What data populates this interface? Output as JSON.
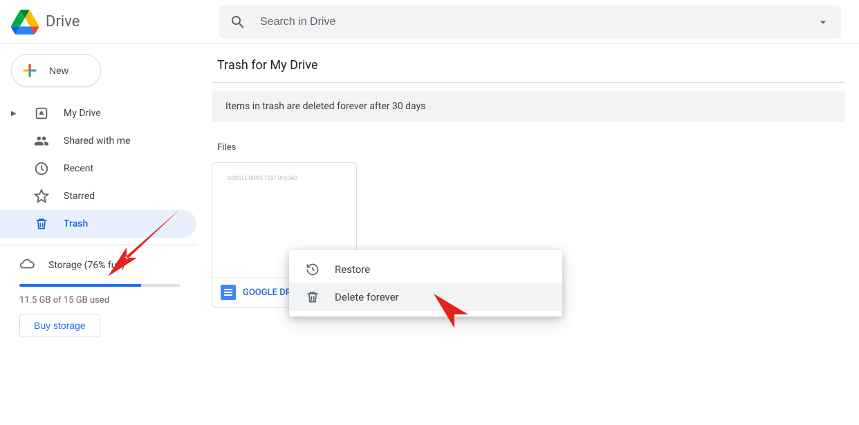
{
  "app": {
    "name": "Drive"
  },
  "search": {
    "placeholder": "Search in Drive"
  },
  "sidebar": {
    "new_label": "New",
    "items": [
      {
        "label": "My Drive"
      },
      {
        "label": "Shared with me"
      },
      {
        "label": "Recent"
      },
      {
        "label": "Starred"
      },
      {
        "label": "Trash"
      }
    ],
    "storage": {
      "label": "Storage (76% full)",
      "percent": 76,
      "usage_text": "11.5 GB of 15 GB used",
      "buy_label": "Buy storage"
    }
  },
  "main": {
    "title": "Trash for My Drive",
    "banner": "Items in trash are deleted forever after 30 days",
    "files_label": "Files",
    "file": {
      "preview_text": "GOOGLE DRIVE TEST UPLOAD",
      "name": "GOOGLE DRIVE…"
    }
  },
  "context_menu": {
    "restore": "Restore",
    "delete": "Delete forever"
  }
}
